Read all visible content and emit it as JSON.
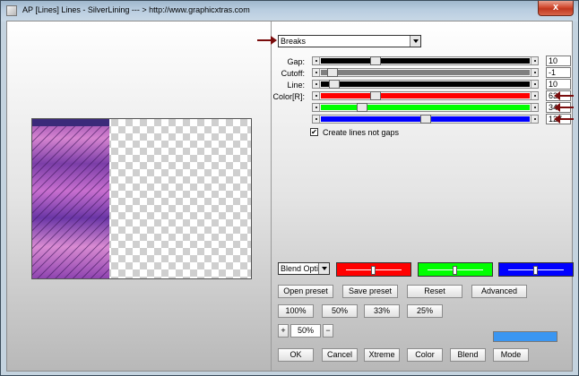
{
  "window": {
    "title": "AP [Lines]  Lines - SilverLining    --- > http://www.graphicxtras.com",
    "close_glyph": "x"
  },
  "controls": {
    "mode_dropdown": {
      "value": "Breaks"
    },
    "gap": {
      "label": "Gap:",
      "value": "10",
      "level": 0.25,
      "color": "#000000"
    },
    "cutoff": {
      "label": "Cutoff:",
      "value": "-1",
      "level": 0.03,
      "color": "#808080"
    },
    "line": {
      "label": "Line:",
      "value": "10",
      "level": 0.04,
      "color": "#000000"
    },
    "color_r": {
      "label": "Color[R]:",
      "value": "63",
      "level": 0.25,
      "color": "#ff0000"
    },
    "color_g": {
      "label": "",
      "value": "34",
      "level": 0.18,
      "color": "#00ff00"
    },
    "color_b": {
      "label": "",
      "value": "127",
      "level": 0.5,
      "color": "#0000ff"
    },
    "create_lines_checkbox": {
      "label": "Create lines not gaps",
      "checked": true,
      "mark": "✔"
    }
  },
  "blend": {
    "options_dropdown": {
      "value": "Blend Opti"
    },
    "mini_sliders": [
      {
        "color": "#ff0000",
        "level": 0.5
      },
      {
        "color": "#00ff00",
        "level": 0.5
      },
      {
        "color": "#0000ff",
        "level": 0.5
      }
    ]
  },
  "buttons": {
    "open_preset": "Open preset",
    "save_preset": "Save preset",
    "reset": "Reset",
    "advanced": "Advanced",
    "zoom_100": "100%",
    "zoom_50": "50%",
    "zoom_33": "33%",
    "zoom_25": "25%",
    "zoom_plus": "+",
    "zoom_value": "50%",
    "zoom_minus": "−",
    "ok": "OK",
    "cancel": "Cancel",
    "xtreme": "Xtreme",
    "color": "Color",
    "blend": "Blend",
    "mode": "Mode"
  },
  "colors": {
    "selected_color": "#3a96f2",
    "annotation_arrow": "#7a0d0d"
  }
}
